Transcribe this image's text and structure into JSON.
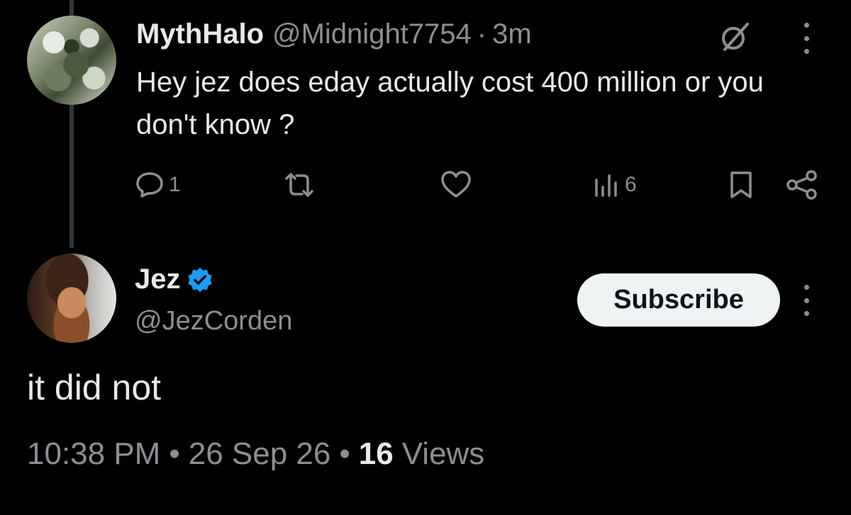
{
  "tweet1": {
    "author_name": "MythHalo",
    "handle": "@Midnight7754",
    "separator": "·",
    "time_ago": "3m",
    "text": "Hey jez does eday actually cost 400 million or you don't know ?",
    "actions": {
      "replies": "1",
      "views": "6"
    }
  },
  "tweet2": {
    "author_name": "Jez",
    "handle": "@JezCorden",
    "subscribe_label": "Subscribe",
    "text": "it did not",
    "meta": {
      "time": "10:38 PM",
      "dot": "•",
      "date": "26 Sep 26",
      "views_count": "16",
      "views_label": "Views"
    }
  },
  "colors": {
    "background": "#000000",
    "text_primary": "#e7e9ea",
    "text_secondary": "#8b8f93",
    "verified_blue": "#1d9bf0",
    "button_bg": "#eff3f4"
  },
  "icons": [
    "grok-icon",
    "more-icon",
    "reply-icon",
    "retweet-icon",
    "like-icon",
    "views-icon",
    "bookmark-icon",
    "share-icon",
    "verified-icon"
  ]
}
